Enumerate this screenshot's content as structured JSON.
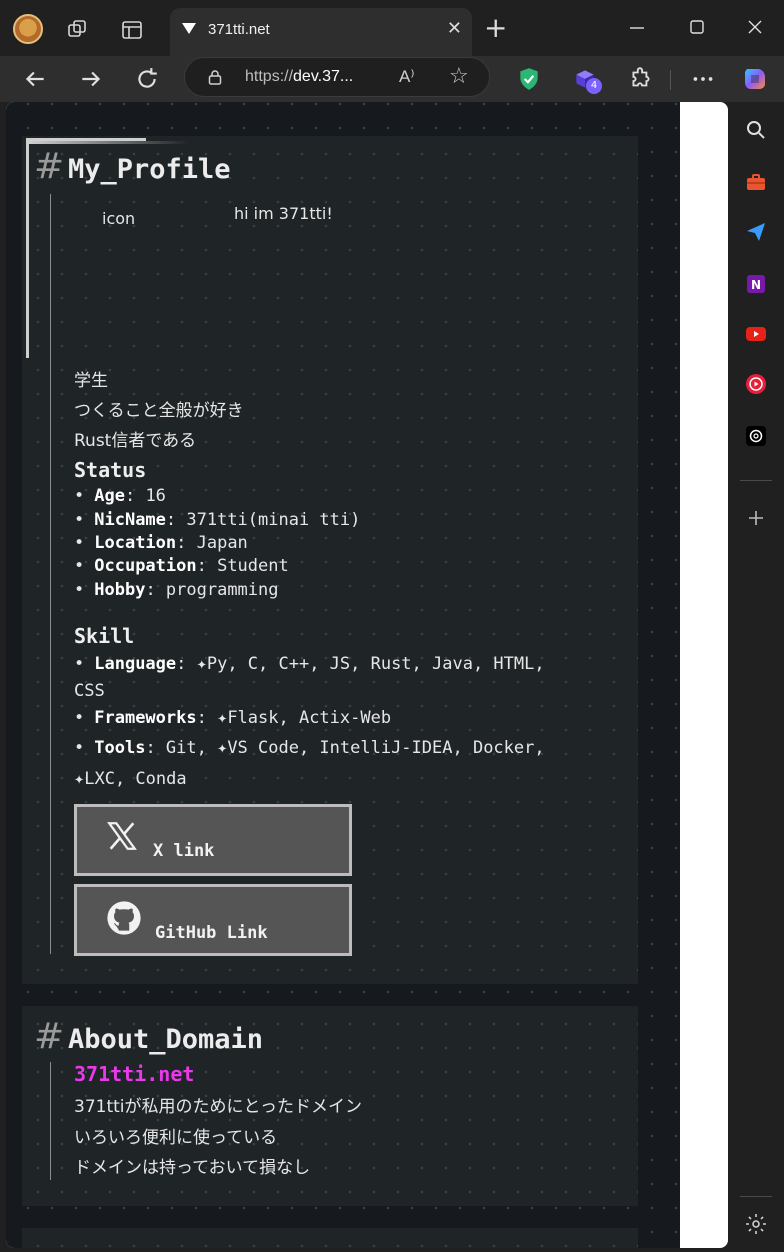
{
  "browser": {
    "tab_title": "371tti.net",
    "url_prefix": "https://",
    "url_host": "dev.37...",
    "read_aloud_label": "A⁾",
    "extension_badge_count": "4"
  },
  "profile_section": {
    "title": "My_Profile",
    "icon_alt": "icon",
    "greeting": "hi im 371tti!",
    "bio": [
      "学生",
      "つくること全般が好き",
      "Rust信者である"
    ],
    "status_heading": "Status",
    "status_items": [
      {
        "key": "Age",
        "value": ": 16"
      },
      {
        "key": "NicName",
        "value": ": 371tti(minai tti)"
      },
      {
        "key": "Location",
        "value": ": Japan"
      },
      {
        "key": "Occupation",
        "value": ": Student"
      },
      {
        "key": "Hobby",
        "value": ": programming"
      }
    ],
    "skill_heading": "Skill",
    "skill_items": [
      {
        "key": "Language",
        "value": ": ✦Py, C, C++, JS, Rust, Java, HTML,",
        "value2": "CSS"
      },
      {
        "key": "Frameworks",
        "value": ": ✦Flask, Actix-Web"
      },
      {
        "key": "Tools",
        "value": ": Git, ✦VS Code, IntelliJ-IDEA, Docker,",
        "value2": "✦LXC, Conda"
      }
    ],
    "x_link_label": "X link",
    "github_link_label": "GitHub Link"
  },
  "domain_section": {
    "title": "About_Domain",
    "domain_link": "371tti.net",
    "lines": [
      "371ttiが私用のためにとったドメイン",
      "いろいろ便利に使っている",
      "ドメインは持っておいて損なし"
    ]
  },
  "colors": {
    "accent_link": "#e83ae8",
    "page_bg": "#161a1e",
    "card_bg": "#202428"
  }
}
